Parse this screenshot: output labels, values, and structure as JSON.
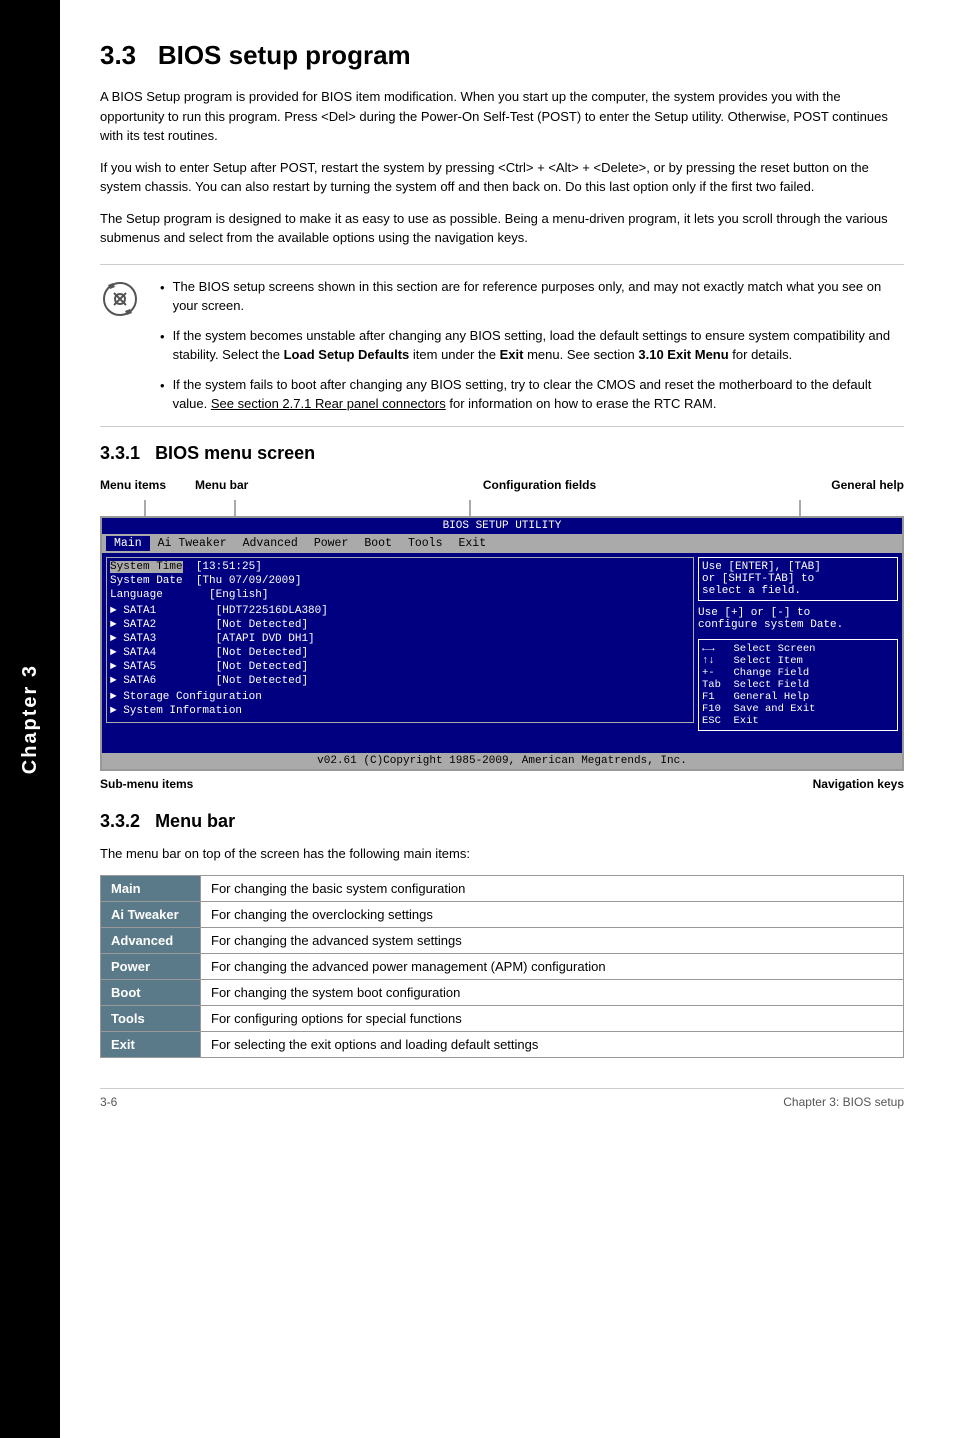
{
  "page": {
    "section_number": "3.3",
    "section_title": "BIOS setup program",
    "chapter_label": "Chapter 3",
    "chapter_short": "Chapter\n3",
    "paragraphs": [
      "A BIOS Setup program is provided for BIOS item modification. When you start up the computer, the system provides you with the opportunity to run this program. Press <Del> during the Power-On Self-Test (POST) to enter the Setup utility. Otherwise, POST continues with its test routines.",
      "If you wish to enter Setup after POST, restart the system by pressing <Ctrl> + <Alt> + <Delete>, or by pressing the reset button on the system chassis. You can also restart by turning the system off and then back on. Do this last option only if the first two failed.",
      "The Setup program is designed to make it as easy to use as possible. Being a menu-driven program, it lets you scroll through the various submenus and select from the available options using the navigation keys."
    ],
    "notes": [
      "The BIOS setup screens shown in this section are for reference purposes only, and may not exactly match what you see on your screen.",
      "If the system becomes unstable after changing any BIOS setting, load the default settings to ensure system compatibility and stability. Select the Load Setup Defaults item under the Exit menu. See section 3.10 Exit Menu for details.",
      "If the system fails to boot after changing any BIOS setting, try to clear the CMOS and reset the motherboard to the default value. See section 2.7.1 Rear panel connectors for information on how to erase the RTC RAM."
    ],
    "note2_bold1": "Load Setup Defaults",
    "note2_bold2": "Exit",
    "note2_regular": "item under the ",
    "note2_ref": "3.10 Exit Menu",
    "note3_underline": "See section 2.7.1 Rear panel connectors",
    "subsection_331": "3.3.1",
    "subsection_331_title": "BIOS menu screen",
    "diagram_labels": {
      "menu_items": "Menu items",
      "menu_bar": "Menu bar",
      "config_fields": "Configuration fields",
      "general_help": "General help"
    },
    "bios_screen": {
      "title": "BIOS SETUP UTILITY",
      "menu_items": [
        "Main",
        "Ai Tweaker",
        "Advanced",
        "Power",
        "Boot",
        "Tools",
        "Exit"
      ],
      "active_menu": "Main",
      "left_fields": [
        {
          "name": "System Time",
          "value": "[13:51:25]"
        },
        {
          "name": "System Date",
          "value": "[Thu 07/09/2009]"
        },
        {
          "name": "Language",
          "value": "[English]"
        },
        {
          "name": "► SATA1",
          "value": "[HDT722516DLA380]"
        },
        {
          "name": "► SATA2",
          "value": "[Not Detected]"
        },
        {
          "name": "► SATA3",
          "value": "[ATAPI DVD DH1]"
        },
        {
          "name": "► SATA4",
          "value": "[Not Detected]"
        },
        {
          "name": "► SATA5",
          "value": "[Not Detected]"
        },
        {
          "name": "► SATA6",
          "value": "[Not Detected]"
        },
        {
          "name": "► Storage Configuration",
          "value": ""
        },
        {
          "name": "► System Information",
          "value": ""
        }
      ],
      "help_text1": "Use [ENTER], [TAB]\nor [SHIFT-TAB] to\nselect a field.",
      "help_text2": "Use [+] or [-] to\nconfigure system Date.",
      "nav_keys": [
        "←→   Select Screen",
        "↑↓   Select Item",
        "+-   Change Field",
        "Tab  Select Field",
        "F1   General Help",
        "F10  Save and Exit",
        "ESC  Exit"
      ],
      "footer": "v02.61  (C)Copyright 1985-2009, American Megatrends, Inc."
    },
    "sub_labels": {
      "submenu": "Sub-menu items",
      "navkeys": "Navigation keys"
    },
    "subsection_332": "3.3.2",
    "subsection_332_title": "Menu bar",
    "menu_bar_intro": "The menu bar on top of the screen has the following main items:",
    "menu_table": [
      {
        "item": "Main",
        "description": "For changing the basic system configuration"
      },
      {
        "item": "Ai Tweaker",
        "description": "For changing the overclocking settings"
      },
      {
        "item": "Advanced",
        "description": "For changing the advanced system settings"
      },
      {
        "item": "Power",
        "description": "For changing the advanced power management (APM) configuration"
      },
      {
        "item": "Boot",
        "description": "For changing the system boot configuration"
      },
      {
        "item": "Tools",
        "description": "For configuring options for special functions"
      },
      {
        "item": "Exit",
        "description": "For selecting the exit options and loading default settings"
      }
    ],
    "footer": {
      "left": "3-6",
      "right": "Chapter 3: BIOS setup"
    }
  }
}
